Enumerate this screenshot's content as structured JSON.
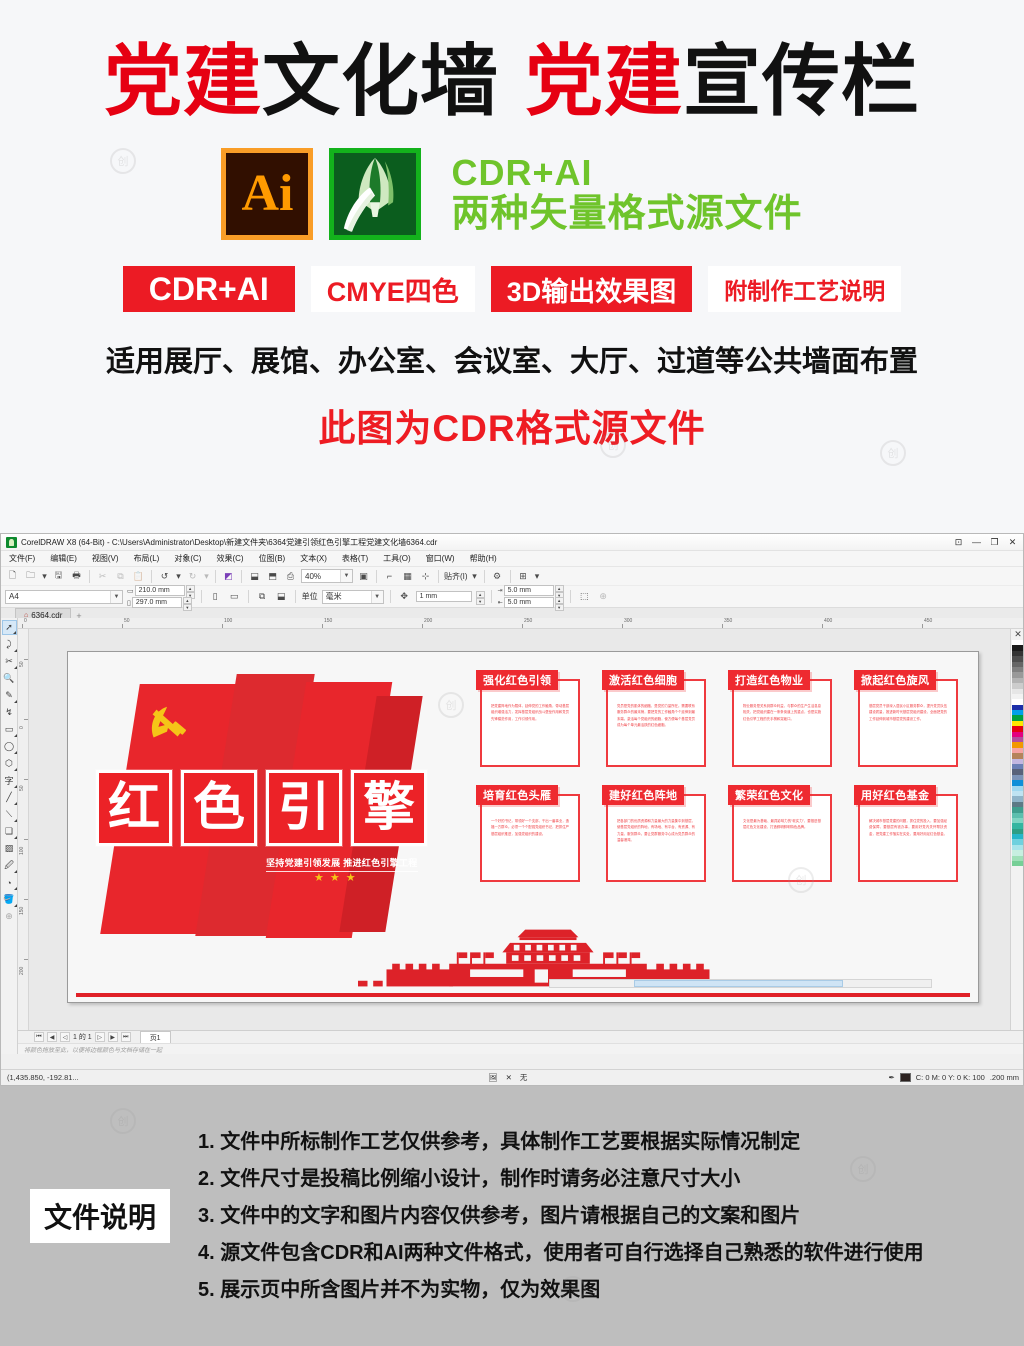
{
  "promo": {
    "title_parts": [
      {
        "text": "党建",
        "color": "red"
      },
      {
        "text": "文化墙",
        "color": "black"
      },
      {
        "text": "党建",
        "color": "red"
      },
      {
        "text": "宣传栏",
        "color": "black"
      }
    ],
    "title_plain": "党建文化墙 党建宣传栏",
    "icons": {
      "ai_label": "Ai",
      "ai_name": "adobe-illustrator-icon",
      "cdr_name": "coreldraw-icon"
    },
    "formats": {
      "line1": "CDR+AI",
      "line2": "两种矢量格式源文件",
      "color": "#6fc42b"
    },
    "badges": [
      {
        "label": "CDR+AI",
        "style": "filled"
      },
      {
        "label": "CMYE四色",
        "style": "hollow"
      },
      {
        "label": "3D输出效果图",
        "style": "filled"
      },
      {
        "label": "附制作工艺说明",
        "style": "hollow"
      }
    ],
    "usage_line": "适用展厅、展馆、办公室、会议室、大厅、过道等公共墙面布置",
    "cdr_line": "此图为CDR格式源文件",
    "accent_red": "#ec1b24"
  },
  "app": {
    "title": "CorelDRAW X8 (64-Bit) - C:\\Users\\Administrator\\Desktop\\新建文件夹\\6364党建引领红色引擎工程党建文化墙6364.cdr",
    "window_controls": {
      "minimize": "—",
      "restore": "❐",
      "close": "✕",
      "restore_doc": "⊡"
    },
    "menus": [
      "文件(F)",
      "编辑(E)",
      "视图(V)",
      "布局(L)",
      "对象(C)",
      "效果(C)",
      "位图(B)",
      "文本(X)",
      "表格(T)",
      "工具(O)",
      "窗口(W)",
      "帮助(H)"
    ],
    "toolbar": {
      "zoom_level": "40%",
      "snap_label": "贴齐(I)",
      "buttons": [
        {
          "name": "new-document",
          "glyph": "🗋"
        },
        {
          "name": "open-document",
          "glyph": "🗀"
        },
        {
          "name": "save-document",
          "glyph": "🖫"
        },
        {
          "name": "print-document",
          "glyph": "🖶"
        },
        {
          "name": "cut",
          "glyph": "✂"
        },
        {
          "name": "copy",
          "glyph": "⧉"
        },
        {
          "name": "paste",
          "glyph": "📋"
        },
        {
          "name": "undo",
          "glyph": "↺"
        },
        {
          "name": "redo",
          "glyph": "↻"
        },
        {
          "name": "import",
          "glyph": "⬓"
        },
        {
          "name": "export",
          "glyph": "⬒"
        },
        {
          "name": "publish-pdf",
          "glyph": "⎙"
        },
        {
          "name": "fullscreen-preview",
          "glyph": "▣"
        },
        {
          "name": "show-rulers",
          "glyph": "⌐"
        },
        {
          "name": "show-grid",
          "glyph": "▦"
        },
        {
          "name": "show-guides",
          "glyph": "⊹"
        },
        {
          "name": "options",
          "glyph": "⚙"
        },
        {
          "name": "application-launcher",
          "glyph": "⊞"
        }
      ]
    },
    "property_bar": {
      "paper_type": "A4",
      "width": "210.0 mm",
      "height": "297.0 mm",
      "unit_label": "单位",
      "unit_value": "毫米",
      "nudge": "1 mm",
      "duplicate_x": "5.0 mm",
      "duplicate_y": "5.0 mm"
    },
    "doc_tab": "6364.cdr",
    "doc_tab_add": "+",
    "toolbox": [
      {
        "name": "pick-tool",
        "glyph": "➚"
      },
      {
        "name": "shape-tool",
        "glyph": "⤸"
      },
      {
        "name": "crop-tool",
        "glyph": "✂"
      },
      {
        "name": "zoom-tool",
        "glyph": "🔍"
      },
      {
        "name": "freehand-tool",
        "glyph": "✎"
      },
      {
        "name": "artistic-media-tool",
        "glyph": "↯"
      },
      {
        "name": "rectangle-tool",
        "glyph": "▭"
      },
      {
        "name": "ellipse-tool",
        "glyph": "◯"
      },
      {
        "name": "polygon-tool",
        "glyph": "⬡"
      },
      {
        "name": "text-tool",
        "glyph": "字"
      },
      {
        "name": "parallel-dimension-tool",
        "glyph": "╱"
      },
      {
        "name": "straight-line-connector-tool",
        "glyph": "⟍"
      },
      {
        "name": "drop-shadow-tool",
        "glyph": "❏"
      },
      {
        "name": "transparency-tool",
        "glyph": "▨"
      },
      {
        "name": "color-eyedropper-tool",
        "glyph": "🖉"
      },
      {
        "name": "interactive-fill-tool",
        "glyph": "◔"
      },
      {
        "name": "smart-fill-tool",
        "glyph": "🪣"
      },
      {
        "name": "quick-customize",
        "glyph": "⊕"
      }
    ],
    "page_nav": {
      "first": "⏮",
      "prev_page": "◀",
      "prev": "◁",
      "counter": "1 的 1",
      "next": "▷",
      "next_page": "▶",
      "last": "⏭",
      "page_tab": "页1"
    },
    "hint_text": "将颜色拖放至此，以便将边框颜色与文档存储在一起",
    "status": {
      "coords": "(1,435.850, -192.81...",
      "outline_none": "无",
      "color_values": "C: 0 M: 0 Y: 0 K: 100",
      "outline_width": ".200 mm"
    },
    "palette_colors": [
      "#ffffff",
      "#1a1a1a",
      "#333333",
      "#4d4d4d",
      "#666666",
      "#808080",
      "#999999",
      "#b3b3b3",
      "#cccccc",
      "#e6e6e6",
      "#f2f2f2",
      "#ffffff",
      "#1b2ea8",
      "#00a0e9",
      "#00a040",
      "#ffe800",
      "#e60012",
      "#e4007f",
      "#b44c9e",
      "#f39800",
      "#f5a3a3",
      "#b5835a",
      "#c3b7e0",
      "#6b7fb5",
      "#58627a",
      "#7b93b8",
      "#0f8fd8",
      "#9fd8f0",
      "#bfe3f2",
      "#8fb4c9",
      "#5d7a86",
      "#3f9e8e",
      "#5cbfae",
      "#7fd4c2",
      "#35b5a0",
      "#2e9e85",
      "#27b6c9",
      "#6fd0de",
      "#a8e4ea",
      "#c7efe0",
      "#9fe0b8",
      "#76cf96"
    ]
  },
  "artwork": {
    "headline_chars": [
      "红",
      "色",
      "引",
      "擎"
    ],
    "subtitle": "坚持党建引领发展  推进红色引擎工程",
    "stars_count": 3,
    "emblem_name": "party-emblem-hammer-sickle",
    "landmark_name": "tiananmen-silhouette",
    "cards": [
      {
        "title": "强化红色引领",
        "body": "把党建阵地作为载体，延伸党的工作触角，带动基层组织增强活力，发挥基层党组织战斗堡垒作用和党员先锋模范作用，工作引领作用。"
      },
      {
        "title": "激活红色细胞",
        "body": "党员是党的肌体的细胞，是党的力量所在。需要联系服务群众的最末梢，要把党的工作触角个个延伸到最末端。激活每个党组织的细胞，使方便每个基层党员成为每个单元最活跃的红色细胞。"
      },
      {
        "title": "打造红色物业",
        "body": "物业服务是关系到群众利益，与群众的生产生活息息相关，把党组织建在一条条街道上的重点，也是实施红色引擎工程的先手棋和突破口。"
      },
      {
        "title": "掀起红色旋风",
        "body": "基层党员干部深入居民小区服务群众，提升党员队伍建设质量，推进新时代基层党组织建设，全面把党的工作延伸到城市基层党的建设工作。"
      },
      {
        "title": "培育红色头雁",
        "body": "一个好的书记，带领好一个支部，干出一番事业，造福一方群众。必须一个个配强党组织书记，把抓住严基层组织推进，加强党组织的建设。"
      },
      {
        "title": "建好红色阵地",
        "body": "把各部门的优质资源和力量最大的力量集中到基层，使基层党组织的阵地，有场地、有平台、有资源、有力量，服务群众。要让党群服务中心成为党员群众的温馨港湾。"
      },
      {
        "title": "繁荣红色文化",
        "body": "文化是最为基础、最具影响力的“软实力”，要推进基层红色文化建设，打造鲜明鲜明特色品牌。"
      },
      {
        "title": "用好红色基金",
        "body": "解决城市基层党建的问题，抓住党的投入，要加强经费保障，要基层有钱办事，要用好党内关怀帮扶资金，把党建工作落实在实处，要用好用足红色基金。"
      }
    ]
  },
  "notes": {
    "label": "文件说明",
    "items": [
      "1. 文件中所标制作工艺仅供参考，具体制作工艺要根据实际情况制定",
      "2. 文件尺寸是投稿比例缩小设计，制作时请务必注意尺寸大小",
      "3. 文件中的文字和图片内容仅供参考，图片请根据自己的文案和图片",
      "4. 源文件包含CDR和AI两种文件格式，使用者可自行选择自己熟悉的软件进行使用",
      "5. 展示页中所含图片并不为实物，仅为效果图"
    ]
  }
}
